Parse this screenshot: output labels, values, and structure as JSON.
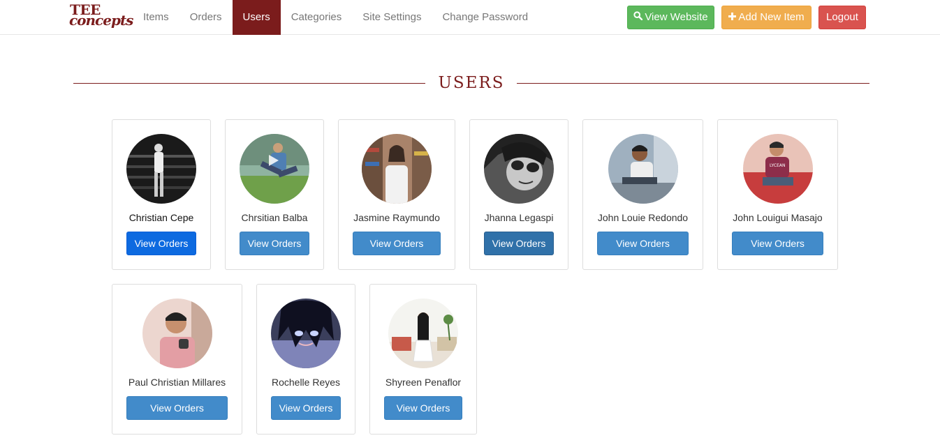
{
  "brand": {
    "line1": "TEE",
    "line2": "concepts"
  },
  "nav": {
    "items": [
      {
        "label": "Items"
      },
      {
        "label": "Orders"
      },
      {
        "label": "Users"
      },
      {
        "label": "Categories"
      },
      {
        "label": "Site Settings"
      },
      {
        "label": "Change Password"
      }
    ],
    "active": "Users",
    "view_website": "View Website",
    "add_new_item": "Add New Item",
    "logout": "Logout"
  },
  "page": {
    "title": "USERS"
  },
  "users": [
    {
      "name": "Christian Cepe",
      "button": "View Orders"
    },
    {
      "name": "Chrsitian Balba",
      "button": "View Orders"
    },
    {
      "name": "Jasmine Raymundo",
      "button": "View Orders"
    },
    {
      "name": "Jhanna Legaspi",
      "button": "View Orders"
    },
    {
      "name": "John Louie Redondo",
      "button": "View Orders"
    },
    {
      "name": "John Louigui Masajo",
      "button": "View Orders"
    },
    {
      "name": "Paul Christian Millares",
      "button": "View Orders"
    },
    {
      "name": "Rochelle Reyes",
      "button": "View Orders"
    },
    {
      "name": "Shyreen Penaflor",
      "button": "View Orders"
    }
  ],
  "colors": {
    "brand": "#7b1c1c",
    "success": "#5cb85c",
    "warning": "#f0ad4e",
    "danger": "#d9534f",
    "primary": "#428bca"
  },
  "icons": {
    "view_website": "search-icon",
    "add_new_item": "plus-icon"
  }
}
